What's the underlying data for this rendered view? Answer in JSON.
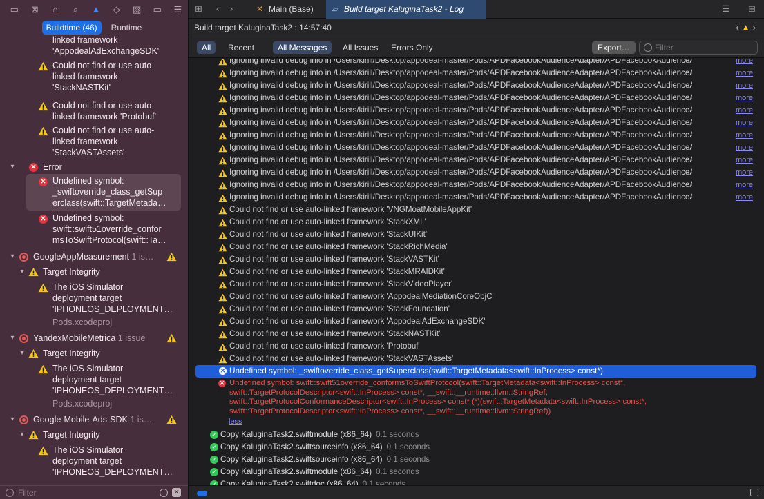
{
  "sidebar": {
    "segments": [
      "Buildtime (46)",
      "Runtime"
    ],
    "filter_placeholder": "Filter",
    "items": [
      {
        "kind": "warning-partial",
        "lines": [
          "linked framework",
          "'AppodealAdExchangeSDK'"
        ]
      },
      {
        "kind": "warning",
        "lines": [
          "Could not find or use auto-",
          "linked framework",
          "'StackNASTKit'"
        ]
      },
      {
        "kind": "warning",
        "lines": [
          "Could not find or use auto-",
          "linked framework 'Protobuf'"
        ]
      },
      {
        "kind": "warning",
        "lines": [
          "Could not find or use auto-",
          "linked framework",
          "'StackVASTAssets'"
        ]
      },
      {
        "kind": "group",
        "label": "Error"
      },
      {
        "kind": "error-selected",
        "lines": [
          "Undefined symbol:",
          "_swiftoverride_class_getSup",
          "erclass(swift::TargetMetada…"
        ]
      },
      {
        "kind": "error",
        "lines": [
          "Undefined symbol:",
          "swift::swift51override_confor",
          "msToSwiftProtocol(swift::Ta…"
        ]
      },
      {
        "kind": "target",
        "label": "GoogleAppMeasurement",
        "count": "1 is…"
      },
      {
        "kind": "subgroup",
        "label": "Target Integrity"
      },
      {
        "kind": "warning",
        "lines": [
          "The iOS Simulator",
          "deployment target",
          "'IPHONEOS_DEPLOYMENT…"
        ],
        "sub": "Pods.xcodeproj"
      },
      {
        "kind": "target",
        "label": "YandexMobileMetrica",
        "count": "1 issue"
      },
      {
        "kind": "subgroup",
        "label": "Target Integrity"
      },
      {
        "kind": "warning",
        "lines": [
          "The iOS Simulator",
          "deployment target",
          "'IPHONEOS_DEPLOYMENT…"
        ],
        "sub": "Pods.xcodeproj"
      },
      {
        "kind": "target",
        "label": "Google-Mobile-Ads-SDK",
        "count": "1 is…"
      },
      {
        "kind": "subgroup",
        "label": "Target Integrity"
      },
      {
        "kind": "warning",
        "lines": [
          "The iOS Simulator",
          "deployment target",
          "'IPHONEOS_DEPLOYMENT…"
        ]
      }
    ]
  },
  "tabs": [
    {
      "label": "Main (Base)",
      "active": false
    },
    {
      "label": "Build target KaluginaTask2 - Log",
      "active": true
    }
  ],
  "breadcrumb": "Build target KaluginaTask2 : 14:57:40",
  "filters": {
    "scope": [
      "All",
      "Recent"
    ],
    "messages": [
      "All Messages",
      "All Issues",
      "Errors Only"
    ],
    "export_label": "Export…",
    "search_placeholder": "Filter"
  },
  "log": {
    "more_label": "more",
    "less_label": "less",
    "debug_warnings": [
      "Ignoring invalid debug info in /Users/kirill/Desktop/appodeal-master/Pods/APDFacebookAudienceAdapter/APDFacebookAudienceAdapter.emb…",
      "Ignoring invalid debug info in /Users/kirill/Desktop/appodeal-master/Pods/APDFacebookAudienceAdapter/APDFacebookAudienceAdapter.emb…",
      "Ignoring invalid debug info in /Users/kirill/Desktop/appodeal-master/Pods/APDFacebookAudienceAdapter/APDFacebookAudienceAdapter.emb…",
      "Ignoring invalid debug info in /Users/kirill/Desktop/appodeal-master/Pods/APDFacebookAudienceAdapter/APDFacebookAudienceAdapter.emb…",
      "Ignoring invalid debug info in /Users/kirill/Desktop/appodeal-master/Pods/APDFacebookAudienceAdapter/APDFacebookAudienceAdapter.emb…",
      "Ignoring invalid debug info in /Users/kirill/Desktop/appodeal-master/Pods/APDFacebookAudienceAdapter/APDFacebookAudienceAdapter.emb…",
      "Ignoring invalid debug info in /Users/kirill/Desktop/appodeal-master/Pods/APDFacebookAudienceAdapter/APDFacebookAudienceAdapter.emb…",
      "Ignoring invalid debug info in /Users/kirill/Desktop/appodeal-master/Pods/APDFacebookAudienceAdapter/APDFacebookAudienceAdapter.emb…",
      "Ignoring invalid debug info in /Users/kirill/Desktop/appodeal-master/Pods/APDFacebookAudienceAdapter/APDFacebookAudienceAdapter.emb…",
      "Ignoring invalid debug info in /Users/kirill/Desktop/appodeal-master/Pods/APDFacebookAudienceAdapter/APDFacebookAudienceAdapter.emb…",
      "Ignoring invalid debug info in /Users/kirill/Desktop/appodeal-master/Pods/APDFacebookAudienceAdapter/APDFacebookAudienceAdapter.emb…",
      "Ignoring invalid debug info in /Users/kirill/Desktop/appodeal-master/Pods/APDFacebookAudienceAdapter/APDFacebookAudienceAdapter.emb…"
    ],
    "framework_warnings": [
      "Could not find or use auto-linked framework 'VNGMoatMobileAppKit'",
      "Could not find or use auto-linked framework 'StackXML'",
      "Could not find or use auto-linked framework 'StackUIKit'",
      "Could not find or use auto-linked framework 'StackRichMedia'",
      "Could not find or use auto-linked framework 'StackVASTKit'",
      "Could not find or use auto-linked framework 'StackMRAIDKit'",
      "Could not find or use auto-linked framework 'StackVideoPlayer'",
      "Could not find or use auto-linked framework 'AppodealMediationCoreObjC'",
      "Could not find or use auto-linked framework 'StackFoundation'",
      "Could not find or use auto-linked framework 'AppodealAdExchangeSDK'",
      "Could not find or use auto-linked framework 'StackNASTKit'",
      "Could not find or use auto-linked framework 'Protobuf'",
      "Could not find or use auto-linked framework 'StackVASTAssets'"
    ],
    "selected_error": "Undefined symbol: _swiftoverride_class_getSuperclass(swift::TargetMetadata<swift::InProcess> const*)",
    "expanded_error": [
      "Undefined symbol: swift::swift51override_conformsToSwiftProtocol(swift::TargetMetadata<swift::InProcess> const*,",
      "swift::TargetProtocolDescriptor<swift::InProcess> const*, __swift::__runtime::llvm::StringRef,",
      "swift::TargetProtocolConformanceDescriptor<swift::InProcess> const* (*)(swift::TargetMetadata<swift::InProcess> const*,",
      "swift::TargetProtocolDescriptor<swift::InProcess> const*, __swift::__runtime::llvm::StringRef))"
    ],
    "copy_steps": [
      {
        "label": "Copy KaluginaTask2.swiftmodule (x86_64)",
        "duration": "0.1 seconds"
      },
      {
        "label": "Copy KaluginaTask2.swiftsourceinfo (x86_64)",
        "duration": "0.1 seconds"
      },
      {
        "label": "Copy KaluginaTask2.swiftsourceinfo (x86_64)",
        "duration": "0.1 seconds"
      },
      {
        "label": "Copy KaluginaTask2.swiftmodule (x86_64)",
        "duration": "0.1 seconds"
      },
      {
        "label": "Copy KaluginaTask2.swiftdoc (x86_64)",
        "duration": "0.1 seconds"
      }
    ]
  },
  "colors": {
    "accent": "#1f6fe5",
    "warning": "#f5c518",
    "error": "#e6323c",
    "success": "#34c759",
    "sidebar_bg": "#472e3c"
  }
}
